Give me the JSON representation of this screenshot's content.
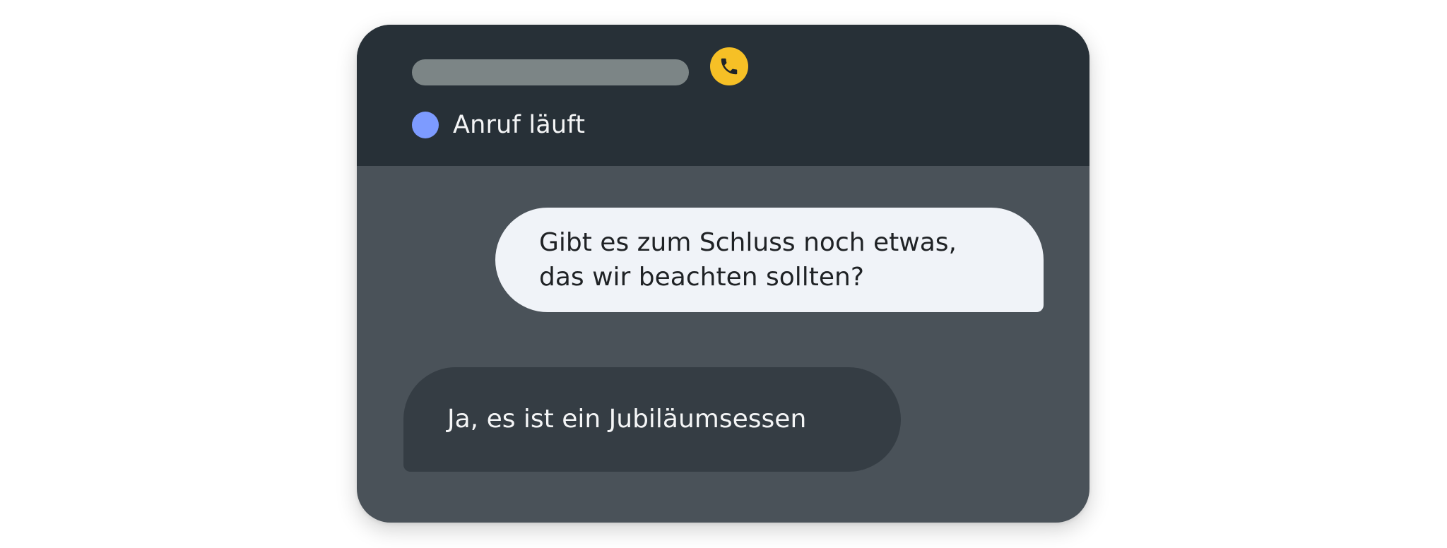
{
  "call": {
    "status_label": "Anruf läuft",
    "status_dot_color": "#7d9bff",
    "phone_badge_color": "#f6c026",
    "phone_icon": "phone-icon"
  },
  "messages": [
    {
      "sender": "outgoing",
      "text": "Gibt es zum Schluss noch etwas,\ndas wir beachten sollten?"
    },
    {
      "sender": "incoming",
      "text": "Ja, es ist ein Jubiläumsessen"
    }
  ]
}
